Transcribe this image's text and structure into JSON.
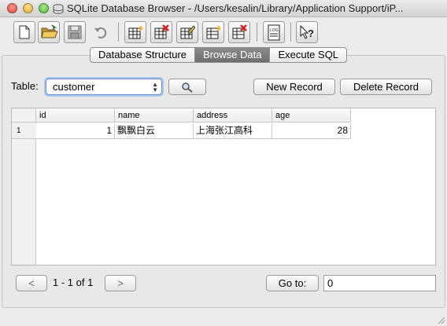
{
  "window": {
    "title": "SQLite Database Browser - /Users/kesalin/Library/Application Support/iP..."
  },
  "toolbar": {
    "buttons": [
      {
        "icon": "new-file-icon"
      },
      {
        "icon": "open-folder-icon"
      },
      {
        "icon": "save-icon"
      },
      {
        "icon": "undo-icon"
      },
      {
        "icon": "create-table-icon"
      },
      {
        "icon": "delete-table-icon"
      },
      {
        "icon": "modify-table-icon"
      },
      {
        "icon": "create-index-icon"
      },
      {
        "icon": "delete-index-icon"
      },
      {
        "icon": "log-icon"
      },
      {
        "icon": "whats-this-icon"
      }
    ],
    "log_label": "LOG"
  },
  "tabs": [
    {
      "label": "Database Structure",
      "active": false
    },
    {
      "label": "Browse Data",
      "active": true
    },
    {
      "label": "Execute SQL",
      "active": false
    }
  ],
  "browse": {
    "table_label": "Table:",
    "table_selected": "customer",
    "new_record": "New Record",
    "delete_record": "Delete Record",
    "columns": [
      "id",
      "name",
      "address",
      "age"
    ],
    "rows": [
      {
        "rownum": "1",
        "id": "1",
        "name": "飘飘白云",
        "address": "上海张江高科",
        "age": "28"
      }
    ],
    "prev": "<",
    "next": ">",
    "page_info": "1 - 1 of 1",
    "goto_label": "Go to:",
    "goto_value": "0"
  },
  "colors": {
    "active_tab": "#7b7b7b",
    "select_focus": "#a8c7f0"
  }
}
